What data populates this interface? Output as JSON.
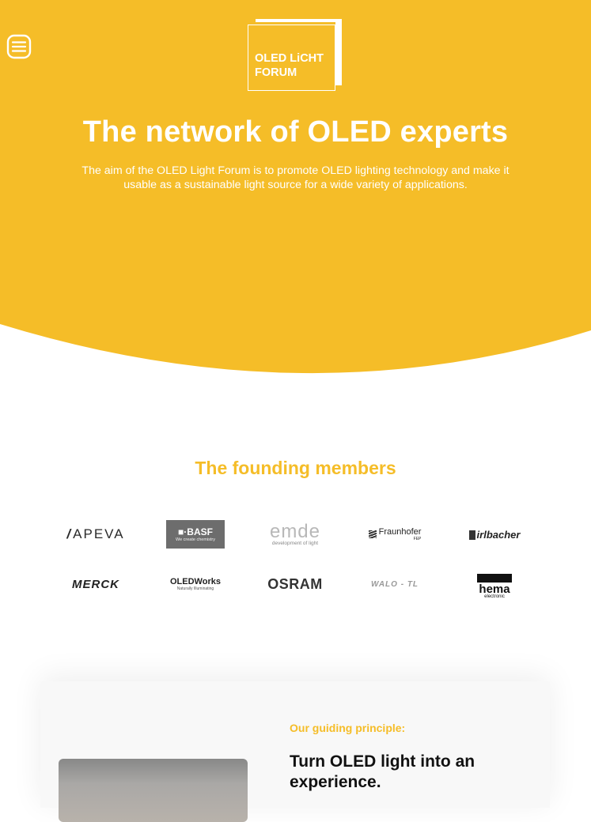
{
  "header": {
    "menu_icon": "hamburger-menu-icon",
    "logo_line1": "OLED LiCHT",
    "logo_line2": "FORUM"
  },
  "hero": {
    "title": "The network of OLED experts",
    "text": "The aim of the OLED Light Forum is to promote OLED lighting technology and make it usable as a sustainable light source for a wide variety of applications.",
    "background_color": "#f5bd28"
  },
  "members": {
    "title": "The founding members",
    "logos": {
      "apeva": "APEVA",
      "basf_main": "BASF",
      "basf_tag": "We create chemistry",
      "emde_main": "emde",
      "emde_tag": "development of light",
      "fraunhofer_main": "Fraunhofer",
      "fraunhofer_tag": "FEP",
      "irlbacher": "irlbacher",
      "merck": "MERCK",
      "oledworks_main": "OLEDWorks",
      "oledworks_tag": "Naturally Illuminating",
      "osram": "OSRAM",
      "walo": "WALO - TL",
      "hema_main": "hema",
      "hema_tag": "electronic"
    }
  },
  "principle": {
    "kicker": "Our guiding principle:",
    "heading": "Turn OLED light into an experience."
  },
  "colors": {
    "accent": "#f5bd28",
    "text_dark": "#111111",
    "card_bg": "#f8f8f8"
  }
}
